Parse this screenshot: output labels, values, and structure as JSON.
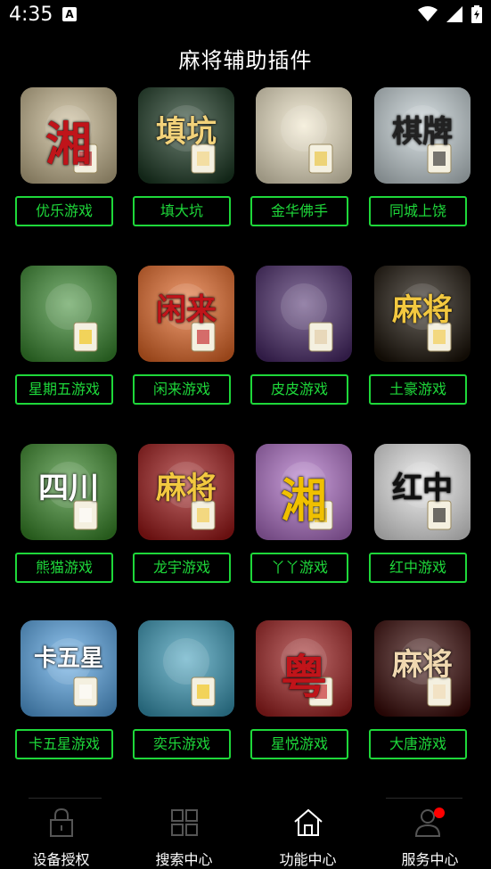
{
  "status": {
    "time": "4:35",
    "badge": "A"
  },
  "title": "麻将辅助插件",
  "games": [
    {
      "name": "优乐游戏",
      "icon_text": "湘",
      "icon": "youle-xiang-icon",
      "bg": "#c8b890",
      "fg": "#c0141a"
    },
    {
      "name": "填大坑",
      "icon_text": "填坑",
      "icon": "tiandakeng-icon",
      "bg": "#1c3a24",
      "fg": "#f2d27a"
    },
    {
      "name": "金华佛手",
      "icon_text": "",
      "icon": "buddha-hand-icon",
      "bg": "#f0e6c8",
      "fg": "#e8c030"
    },
    {
      "name": "同城上饶",
      "icon_text": "棋牌",
      "icon": "tongcheng-shangrao-icon",
      "bg": "#c8d4d8",
      "fg": "#222222"
    },
    {
      "name": "星期五游戏",
      "icon_text": "",
      "icon": "xingqiwu-girl-icon",
      "bg": "#3a8a30",
      "fg": "#f0c000"
    },
    {
      "name": "闲来游戏",
      "icon_text": "闲来",
      "icon": "xianlai-girl-icon",
      "bg": "#e86a28",
      "fg": "#c0141a"
    },
    {
      "name": "皮皮游戏",
      "icon_text": "",
      "icon": "pipi-girl-icon",
      "bg": "#4a2a6a",
      "fg": "#e0c8a0"
    },
    {
      "name": "土豪游戏",
      "icon_text": "麻将",
      "icon": "tuhao-mahjong-icon",
      "bg": "#1a1208",
      "fg": "#f2c840"
    },
    {
      "name": "熊猫游戏",
      "icon_text": "四川",
      "icon": "panda-icon",
      "bg": "#3a8a2a",
      "fg": "#ffffff"
    },
    {
      "name": "龙宇游戏",
      "icon_text": "麻将",
      "icon": "longyu-mahjong-icon",
      "bg": "#a01818",
      "fg": "#f2c840"
    },
    {
      "name": "丫丫游戏",
      "icon_text": "湘",
      "icon": "yaya-girl-icon",
      "bg": "#b070c8",
      "fg": "#f0c000"
    },
    {
      "name": "红中游戏",
      "icon_text": "红中",
      "icon": "hongzhong-icon",
      "bg": "#e8e8e8",
      "fg": "#111111"
    },
    {
      "name": "卡五星游戏",
      "icon_text": "卡五星",
      "icon": "kawuxing-girl-icon",
      "bg": "#5aa8e8",
      "fg": "#ffffff"
    },
    {
      "name": "奕乐游戏",
      "icon_text": "",
      "icon": "yile-girl-icon",
      "bg": "#3a9ab8",
      "fg": "#f0c000"
    },
    {
      "name": "星悦游戏",
      "icon_text": "粤",
      "icon": "xingyue-mahjong-icon",
      "bg": "#a02020",
      "fg": "#c0141a"
    },
    {
      "name": "大唐游戏",
      "icon_text": "麻将",
      "icon": "datang-mahjong-icon",
      "bg": "#3a0a08",
      "fg": "#f0d8b0"
    }
  ],
  "tabs": [
    {
      "label": "设备授权",
      "icon": "lock-icon"
    },
    {
      "label": "搜索中心",
      "icon": "grid-icon"
    },
    {
      "label": "功能中心",
      "icon": "home-icon"
    },
    {
      "label": "服务中心",
      "icon": "user-icon"
    }
  ],
  "colors": {
    "accent": "#1ed83a",
    "badge": "#ff0000",
    "background": "#000000"
  }
}
